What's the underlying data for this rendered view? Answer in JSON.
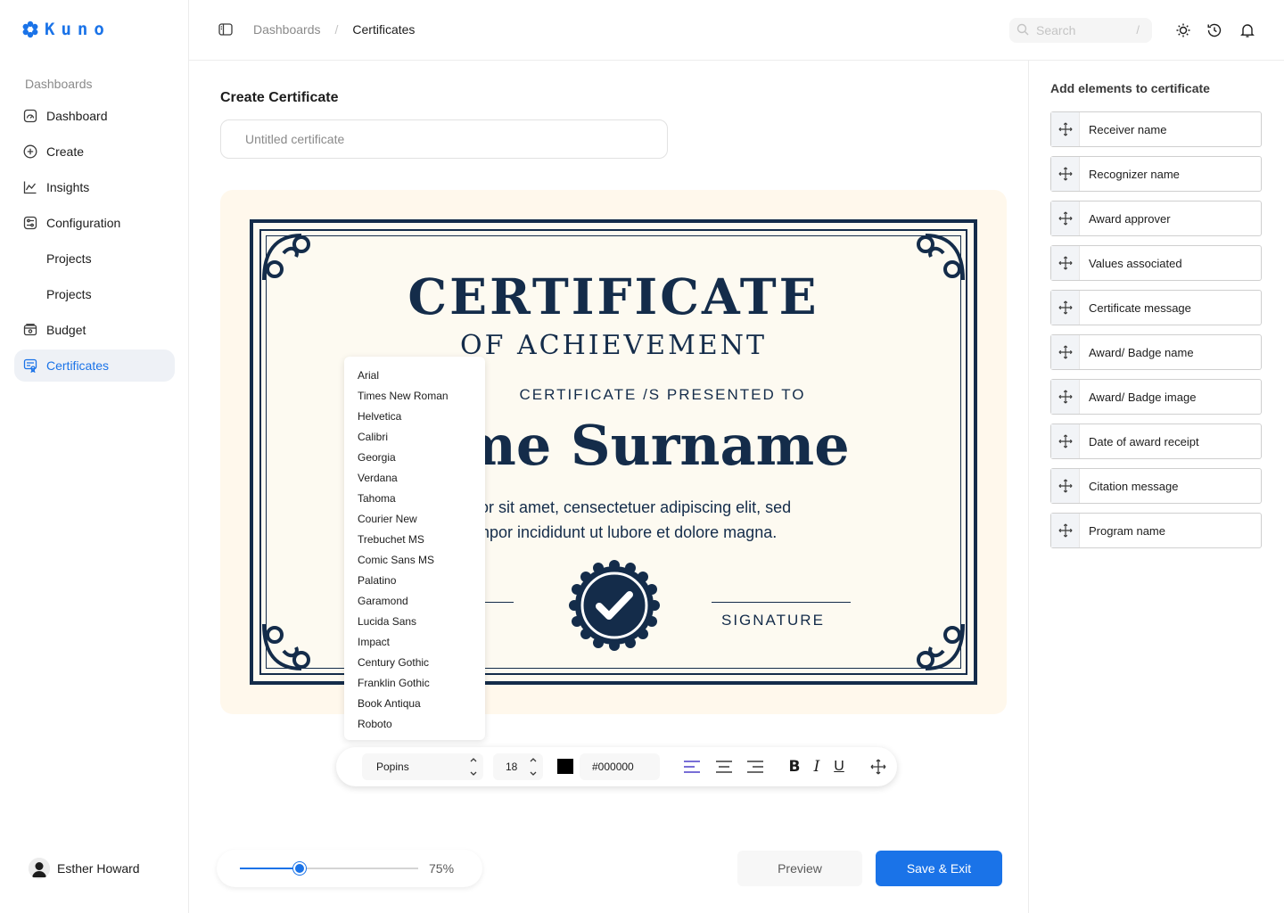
{
  "brand": {
    "name": "Kuno",
    "accent": "#1a73e8"
  },
  "sidebar": {
    "section_label": "Dashboards",
    "items": [
      {
        "label": "Dashboard",
        "icon": "dashboard-icon"
      },
      {
        "label": "Create",
        "icon": "plus-circle-icon"
      },
      {
        "label": "Insights",
        "icon": "chart-icon"
      },
      {
        "label": "Configuration",
        "icon": "sliders-icon"
      },
      {
        "label": "Projects"
      },
      {
        "label": "Projects"
      },
      {
        "label": "Budget",
        "icon": "wallet-icon"
      },
      {
        "label": "Certificates",
        "icon": "certificate-icon",
        "active": true
      }
    ],
    "user": {
      "name": "Esther Howard"
    }
  },
  "topbar": {
    "breadcrumb": [
      "Dashboards",
      "/",
      "Certificates"
    ],
    "search_placeholder": "Search",
    "search_shortcut": "/"
  },
  "main": {
    "title": "Create Certificate",
    "name_placeholder": "Untitled certificate"
  },
  "certificate": {
    "heading": "CERTIFICATE",
    "subheading": "OF ACHIEVEMENT",
    "presented": "CERTIFICATE /S PRESENTED TO",
    "name": "me Surname",
    "body_line1": "olor sit amet, censectetuer adipiscing elit, sed",
    "body_line2": "empor incididunt ut lubore et dolore magna.",
    "signature_label": "SIGNATURE",
    "ink_color": "#142c4a"
  },
  "font_menu": {
    "options": [
      "Arial",
      "Times New Roman",
      "Helvetica",
      "Calibri",
      "Georgia",
      "Verdana",
      "Tahoma",
      "Courier New",
      "Trebuchet MS",
      "Comic Sans MS",
      "Palatino",
      "Garamond",
      "Lucida Sans",
      "Impact",
      "Century Gothic",
      "Franklin Gothic",
      "Book Antiqua",
      "Roboto"
    ]
  },
  "toolbar": {
    "font": "Popins",
    "size": "18",
    "color_hex": "#000000",
    "bold_label": "B",
    "italic_label": "I",
    "underline_label": "U"
  },
  "zoom": {
    "value": 0.75,
    "label": "75%"
  },
  "actions": {
    "preview_label": "Preview",
    "save_label": "Save & Exit"
  },
  "elements_panel": {
    "title": "Add elements to certificate",
    "items": [
      "Receiver name",
      "Recognizer name",
      "Award approver",
      "Values associated",
      "Certificate message",
      "Award/ Badge name",
      "Award/ Badge image",
      "Date of award receipt",
      "Citation message",
      "Program name"
    ]
  }
}
